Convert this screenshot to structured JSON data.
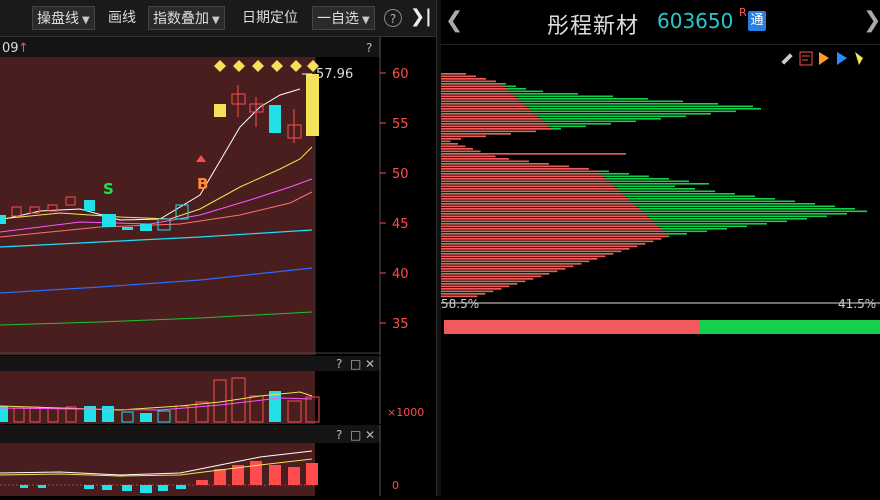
{
  "toolbar": {
    "drawline": "操盘线",
    "draw": "画线",
    "overlay": "指数叠加",
    "date_locate": "日期定位",
    "watchlist": "一自选",
    "help": "?",
    "collapse": "❯|"
  },
  "main_chart": {
    "date_fragment": "09",
    "help": "?",
    "high_label": "57.96",
    "buy_mark": "B",
    "sell_mark": "S",
    "yaxis_ticks": [
      "60",
      "55",
      "50",
      "45",
      "40",
      "35"
    ]
  },
  "sub_panel_1": {
    "help": "?",
    "max": "□",
    "close": "✕",
    "unit_label": "×1000"
  },
  "sub_panel_2": {
    "help": "?",
    "max": "□",
    "close": "✕",
    "axis_label": "0"
  },
  "stock": {
    "name": "彤程新材",
    "code": "603650",
    "r_mark": "R",
    "tong": "通",
    "nav_prev": "❮",
    "nav_next": "❯"
  },
  "chip": {
    "left_pct": "58.5%",
    "right_pct": "41.5%",
    "profit_ratio": 0.585,
    "profit_color": "#f05a5a",
    "loss_color": "#14d04a"
  },
  "colors": {
    "up": "#ff4d4d",
    "down": "#22e0e8",
    "ma5": "#ffffff",
    "ma10": "#f2e35a",
    "ma20": "#ff55ff",
    "ma60": "#1fe0ff",
    "ma120": "#2b6cff",
    "ma250": "#20c030"
  }
}
